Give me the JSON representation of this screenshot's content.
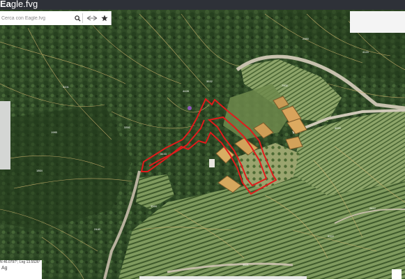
{
  "app": {
    "logo_prefix": "Ea",
    "logo_suffix": "gle.fvg"
  },
  "search": {
    "placeholder": "Cerca con Eagle.fvg",
    "search_icon": "search-icon",
    "close_icon": "close-icon",
    "swap_icon": "swap-arrows-icon",
    "favorite_icon": "star-icon"
  },
  "coords": {
    "text": "N 46.0797°, Lng 13.5526°",
    "label": "Ag"
  },
  "parcels": [
    "3431",
    "4428",
    "1985",
    "3392",
    "3433",
    "3532",
    "1864",
    "3534",
    "2960",
    "4120",
    "4020",
    "2812",
    "5322",
    "4421",
    "2440",
    "7002"
  ],
  "colors": {
    "parcel_line": "#c9b06b",
    "selection": "#e21b1b",
    "marker": "#9b59d0",
    "topbar": "#2e3138"
  }
}
